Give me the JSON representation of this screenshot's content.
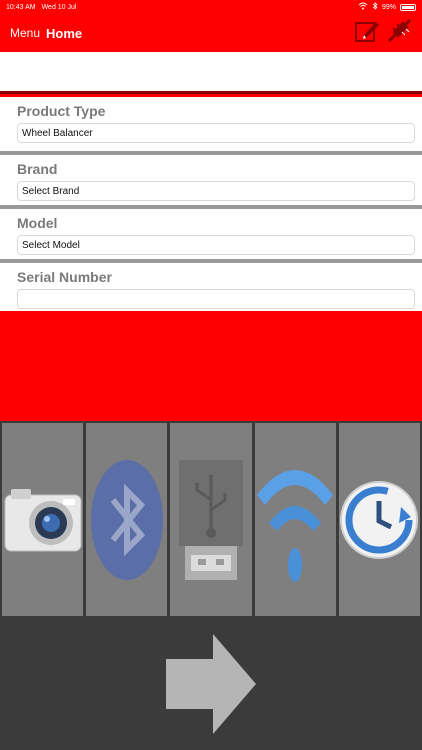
{
  "status": {
    "time": "10:43 AM",
    "date": "Wed 10 Jul",
    "battery": "99%"
  },
  "nav": {
    "menu_label": "Menu",
    "title": "Home",
    "icons": [
      "edit-icon",
      "disconnect-plug-icon"
    ]
  },
  "form": {
    "product_type": {
      "label": "Product Type",
      "value": "Wheel Balancer"
    },
    "brand": {
      "label": "Brand",
      "value": "Select Brand"
    },
    "model": {
      "label": "Model",
      "value": "Select Model"
    },
    "serial_number": {
      "label": "Serial Number",
      "value": ""
    }
  },
  "tiles": [
    "camera-icon",
    "bluetooth-icon",
    "usb-icon",
    "wifi-icon",
    "history-clock-icon"
  ],
  "actions": {
    "next_icon": "arrow-right-icon"
  },
  "colors": {
    "background": "#ff0000",
    "tile": "#7f7f7f",
    "dark": "#3b3b3b",
    "label": "#7a7a7a"
  }
}
